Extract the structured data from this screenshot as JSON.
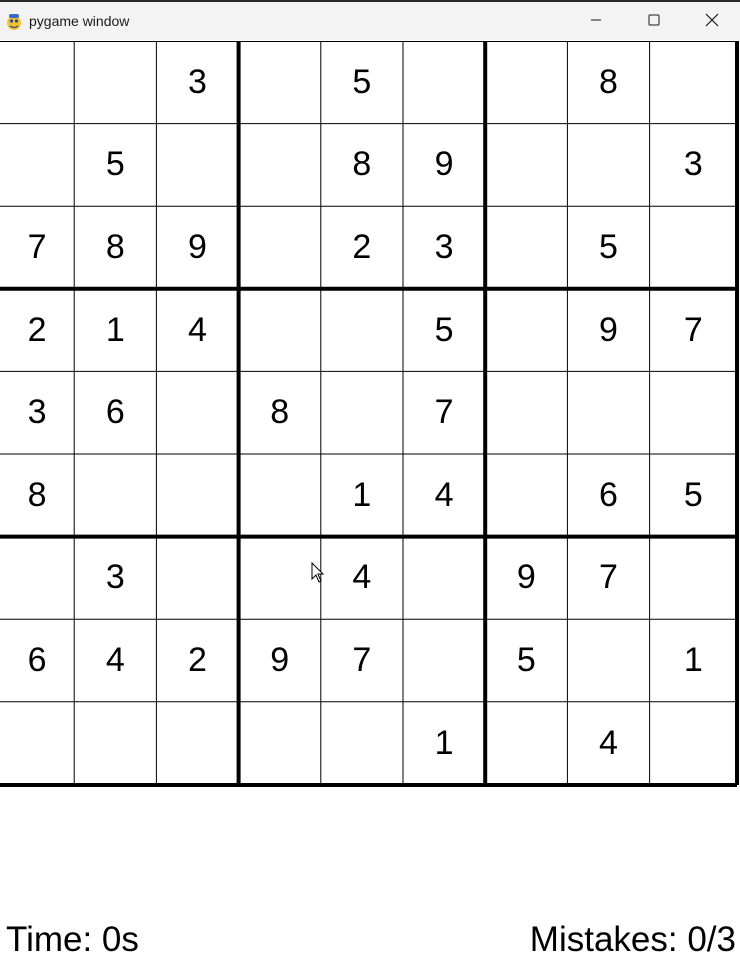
{
  "window": {
    "title": "pygame window",
    "icon": "pygame-snake-icon",
    "controls": [
      "minimize-icon",
      "maximize-icon",
      "close-icon"
    ]
  },
  "board": {
    "grid": [
      [
        "",
        "",
        "3",
        "",
        "5",
        "",
        "",
        "8",
        ""
      ],
      [
        "",
        "5",
        "",
        "",
        "8",
        "9",
        "",
        "",
        "3"
      ],
      [
        "7",
        "8",
        "9",
        "",
        "2",
        "3",
        "",
        "5",
        ""
      ],
      [
        "2",
        "1",
        "4",
        "",
        "",
        "5",
        "",
        "9",
        "7"
      ],
      [
        "3",
        "6",
        "",
        "8",
        "",
        "7",
        "",
        "",
        ""
      ],
      [
        "8",
        "",
        "",
        "",
        "1",
        "4",
        "",
        "6",
        "5"
      ],
      [
        "",
        "3",
        "",
        "",
        "4",
        "",
        "9",
        "7",
        ""
      ],
      [
        "6",
        "4",
        "2",
        "9",
        "7",
        "",
        "5",
        "",
        "1"
      ],
      [
        "",
        "",
        "",
        "",
        "",
        "1",
        "",
        "4",
        ""
      ]
    ]
  },
  "status": {
    "time": "Time: 0s",
    "mistakes": "Mistakes: 0/3"
  },
  "colors": {
    "titlebar": "#f3f3f3",
    "background": "#ffffff",
    "grid_lines": "#000000",
    "digits": "#000000"
  }
}
